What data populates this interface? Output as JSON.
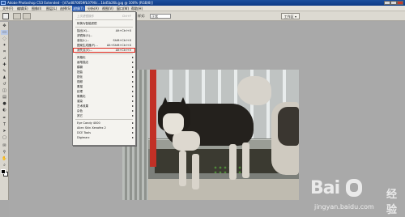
{
  "window": {
    "title": "Adobe Photoshop CS3 Extended - [d7a4870059fb3790c...1bd5b26b.jpg @ 100% (RGB/8)]"
  },
  "menubar": {
    "items": [
      "文件(F)",
      "编辑(E)",
      "图像(I)",
      "图层(L)",
      "选择(S)",
      "滤镜(T)",
      "分析(A)",
      "视图(V)",
      "窗口(W)",
      "帮助(H)"
    ],
    "active": "滤镜(T)"
  },
  "options_bar": {
    "field1": "正常",
    "label_mode": "样式:",
    "style_value": "正常",
    "workspace_label": "工作区 ▾"
  },
  "filter_menu": {
    "rows": [
      {
        "label": "上次滤镜操作",
        "shortcut": "Ctrl+F",
        "disabled": true
      },
      {
        "label": "转换为智能滤镜",
        "shortcut": "",
        "disabled": false
      },
      {
        "label": "抽出(X)...",
        "shortcut": "Alt+Ctrl+X",
        "disabled": false
      },
      {
        "label": "滤镜库(G)...",
        "shortcut": "",
        "disabled": false
      },
      {
        "label": "液化(L)...",
        "shortcut": "Shift+Ctrl+X",
        "disabled": false
      },
      {
        "label": "图案生成器(P)...",
        "shortcut": "Alt+Shift+Ctrl+X",
        "disabled": false
      },
      {
        "label": "消失点(V)...",
        "shortcut": "Alt+Ctrl+V",
        "disabled": false,
        "highlight": true
      },
      {
        "label": "风格化",
        "submenu": true
      },
      {
        "label": "画笔描边",
        "submenu": true
      },
      {
        "label": "模糊",
        "submenu": true
      },
      {
        "label": "扭曲",
        "submenu": true
      },
      {
        "label": "锐化",
        "submenu": true
      },
      {
        "label": "视频",
        "submenu": true
      },
      {
        "label": "素描",
        "submenu": true
      },
      {
        "label": "纹理",
        "submenu": true
      },
      {
        "label": "像素化",
        "submenu": true
      },
      {
        "label": "渲染",
        "submenu": true
      },
      {
        "label": "艺术效果",
        "submenu": true
      },
      {
        "label": "杂色",
        "submenu": true
      },
      {
        "label": "其它",
        "submenu": true
      },
      {
        "label": "Eye Candy 4000",
        "submenu": true
      },
      {
        "label": "Alien Skin Xenofex 2",
        "submenu": true
      },
      {
        "label": "DCE Tools",
        "submenu": true
      },
      {
        "label": "Digimarc",
        "submenu": true
      }
    ]
  },
  "watermark": {
    "brand": "Bai",
    "brand2": "经验",
    "url": "jingyan.baidu.com"
  },
  "colors": {
    "menu_highlight": "#e0261b",
    "titlebar": "#1d4f9e",
    "workspace": "#a9a9a9"
  }
}
